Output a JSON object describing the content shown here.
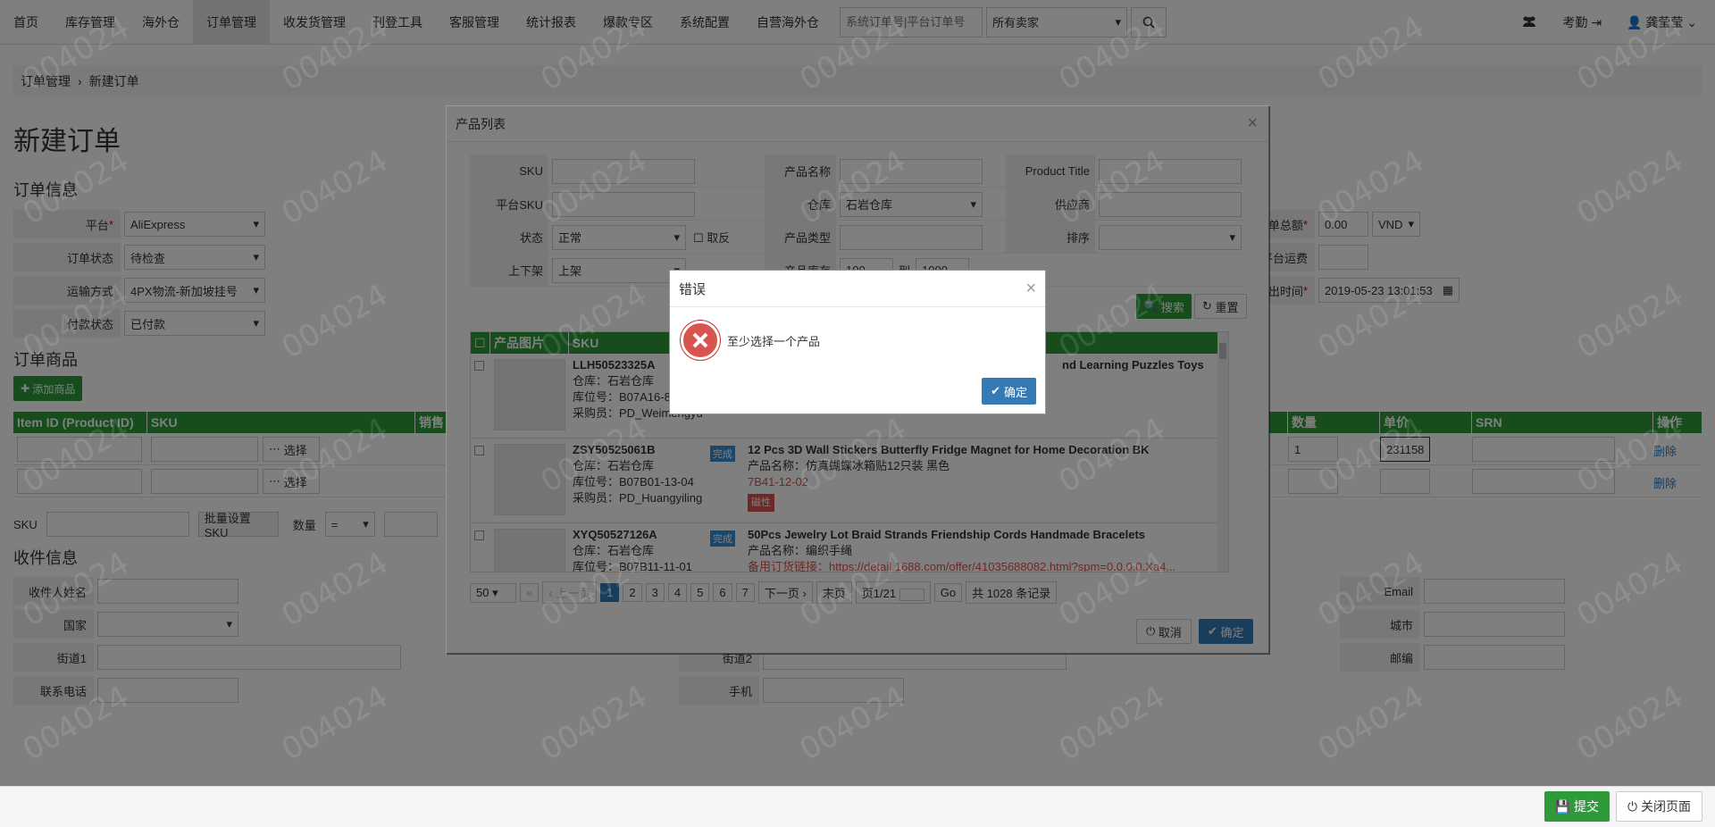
{
  "nav": {
    "items": [
      "首页",
      "库存管理",
      "海外仓",
      "订单管理",
      "收发货管理",
      "刊登工具",
      "客服管理",
      "统计报表",
      "爆款专区",
      "系统配置",
      "自营海外仓"
    ],
    "search_placeholder": "系统订单号|平台订单号",
    "seller_select": "所有卖家",
    "attendance": "考勤",
    "user": "龚莹莹"
  },
  "breadcrumb": {
    "level1": "订单管理",
    "sep": "›",
    "level2": "新建订单"
  },
  "page_title": "新建订单",
  "order_info": {
    "title": "订单信息",
    "platform_label": "平台",
    "platform_value": "AliExpress",
    "status_label": "订单状态",
    "status_value": "待检查",
    "shipping_label": "运输方式",
    "shipping_value": "4PX物流-新加坡挂号",
    "payment_label": "付款状态",
    "payment_value": "已付款",
    "total_label": "单总额",
    "total_value": "0.00",
    "currency": "VND",
    "freight_label": "平台运费",
    "time_label": "出时间",
    "time_value": "2019-05-23 13:01:53"
  },
  "order_products": {
    "title": "订单商品",
    "add_btn": "添加商品",
    "headers": [
      "Item ID (Product ID)",
      "SKU",
      "销售",
      "数量",
      "单价",
      "SRN",
      "操作"
    ],
    "select_btn": "选择",
    "delete": "删除",
    "row1_qty": "1",
    "row1_price": "231158"
  },
  "sku_bar": {
    "sku_label": "SKU",
    "batch_btn": "批量设置SKU",
    "qty_label": "数量",
    "qty_op": "="
  },
  "recipient": {
    "title": "收件信息",
    "name": "收件人姓名",
    "country": "国家",
    "street1": "街道1",
    "street2": "街道2",
    "phone": "联系电话",
    "mobile": "手机",
    "email": "Email",
    "city": "城市",
    "zip": "邮编"
  },
  "bottom": {
    "submit": "提交",
    "close_page": "关闭页面"
  },
  "product_modal": {
    "title": "产品列表",
    "filters": {
      "sku": "SKU",
      "product_name": "产品名称",
      "product_title": "Product Title",
      "platform_sku": "平台SKU",
      "warehouse": "仓库",
      "warehouse_value": "石岩仓库",
      "supplier": "供应商",
      "status": "状态",
      "status_value": "正常",
      "invert": "取反",
      "product_type": "产品类型",
      "sort": "排序",
      "shelf": "上下架",
      "shelf_value": "上架",
      "stock": "产品库存",
      "stock_from": "100",
      "stock_to_label": "到",
      "stock_to": "1000"
    },
    "search_btn": "搜索",
    "reset_btn": "重置",
    "headers": [
      "产品图片",
      "SKU"
    ],
    "rows": [
      {
        "sku": "LLH50523325A",
        "warehouse": "仓库：石岩仓库",
        "location": "库位号：B07A16-8",
        "buyer": "采购员：PD_Weimengyu",
        "title": "nd Learning Puzzles Toys"
      },
      {
        "sku": "ZSY50525061B",
        "warehouse": "仓库：石岩仓库",
        "location": "库位号：B07B01-13-04",
        "buyer": "采购员：PD_Huangyiling",
        "status": "完成",
        "title": "12 Pcs 3D Wall Stickers Butterfly Fridge Magnet for Home Decoration BK",
        "name": "产品名称：仿真蝴蝶冰箱贴12只装 黑色",
        "code": "7B41-12-02",
        "badge": "磁性"
      },
      {
        "sku": "XYQ50527126A",
        "warehouse": "仓库：石岩仓库",
        "location": "库位号：B07B11-11-01",
        "status": "完成",
        "title": "50Pcs Jewelry Lot Braid Strands Friendship Cords Handmade Bracelets",
        "name": "产品名称：编织手绳",
        "link": "备用订货链接：https://detail.1688.com/offer/41035688082.html?spm=0.0.0.0.Xa4..."
      }
    ],
    "pager": {
      "size": "50",
      "first": "«",
      "prev": "‹ 上一页",
      "pages": [
        "1",
        "2",
        "3",
        "4",
        "5",
        "6",
        "7"
      ],
      "next": "下一页 ›",
      "last": "末页",
      "page_of": "页1/21",
      "go": "Go",
      "total": "共 1028 条记录"
    },
    "cancel": "取消",
    "confirm": "确定"
  },
  "error_dialog": {
    "title": "错误",
    "message": "至少选择一个产品",
    "confirm": "确定"
  }
}
